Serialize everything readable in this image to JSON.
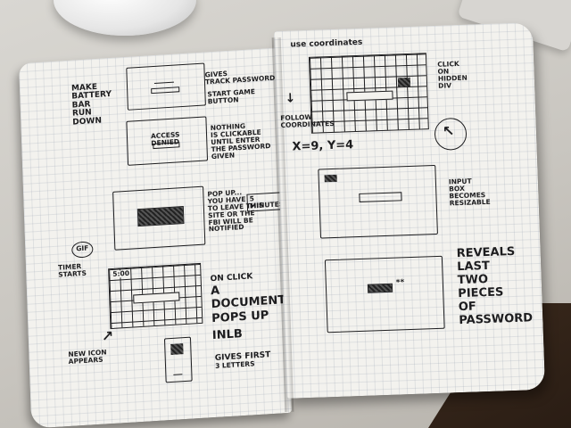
{
  "left_page": {
    "make_battery": [
      "MAKE",
      "BATTERY",
      "BAR",
      "RUN",
      "DOWN"
    ],
    "gives_track_password": [
      "GIVES",
      "TRACK PASSWORD"
    ],
    "start_game_button": [
      "START GAME",
      "BUTTON"
    ],
    "access_denied": "ACCESS DENIED",
    "nothing_clickable": [
      "NOTHING",
      "IS CLICKABLE",
      "UNTIL ENTER",
      "THE PASSWORD",
      "GIVEN"
    ],
    "pop_up": [
      "POP UP...",
      "YOU HAVE",
      "TO LEAVE THIS",
      "SITE OR THE",
      "FBI WILL BE",
      "NOTIFIED"
    ],
    "five_minutes": "5 MINUTES",
    "gif_badge": "GIF",
    "timer_started": [
      "TIMER",
      "STARTS"
    ],
    "timer_value": "5:00",
    "on_click": [
      "ON CLICK",
      "A DOCUMENT",
      "POPS UP"
    ],
    "inlb": "INLB",
    "gives_first": [
      "GIVES FIRST",
      "3 LETTERS"
    ],
    "new_icon": [
      "NEW ICON",
      "APPEARS"
    ]
  },
  "right_page": {
    "coordinates_title": "use coordinates",
    "follow_coordinates": [
      "FOLLOW",
      "COORDINATES"
    ],
    "coordinates_value": "X=9, Y=4",
    "click_hidden_div": [
      "CLICK",
      "ON",
      "HIDDEN",
      "DIV"
    ],
    "input_box": [
      "INPUT",
      "BOX",
      "BECOMES",
      "RESIZABLE"
    ],
    "reveal_stars": "**",
    "reveals_last": [
      "REVEALS",
      "LAST",
      "TWO",
      "PIECES",
      "OF",
      "PASSWORD"
    ]
  },
  "colors": {
    "ink": "#1d1d1f",
    "paper": "#f3f2ee",
    "desk": "#c9c6c0"
  }
}
